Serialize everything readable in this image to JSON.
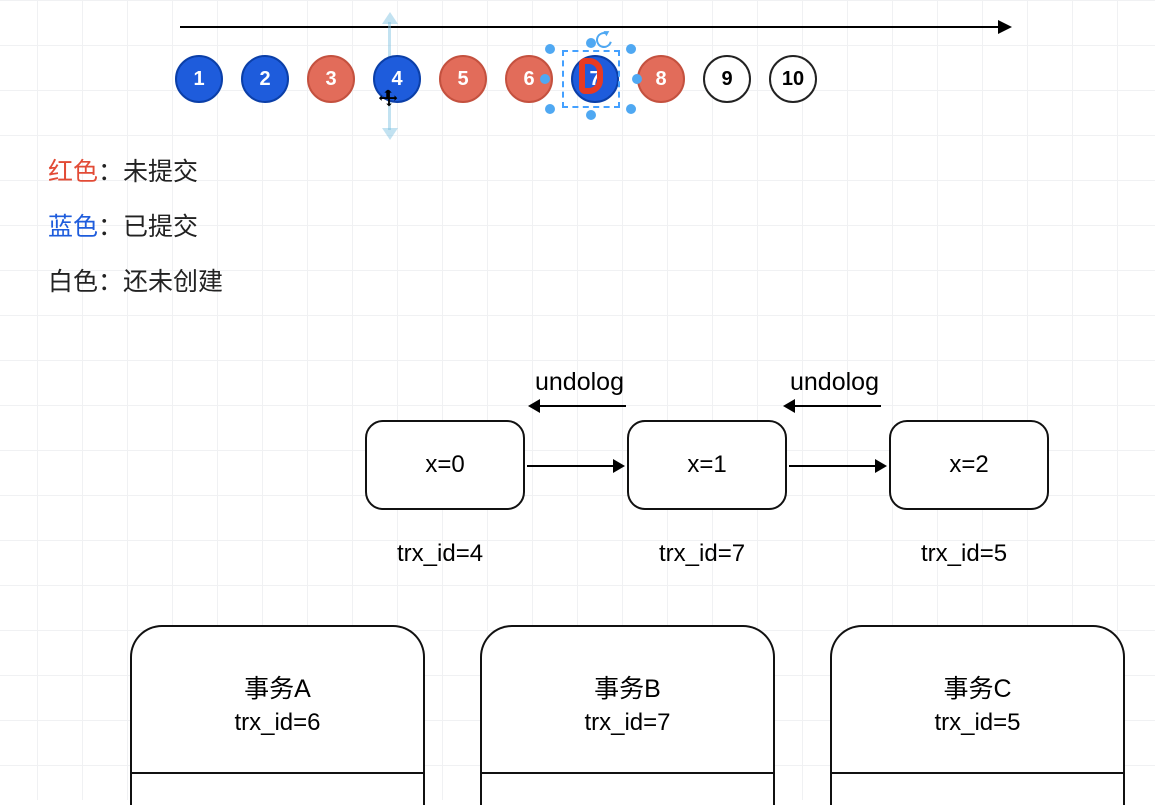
{
  "timeline": {
    "circles": [
      {
        "n": "1",
        "color": "blue"
      },
      {
        "n": "2",
        "color": "blue"
      },
      {
        "n": "3",
        "color": "red"
      },
      {
        "n": "4",
        "color": "blue"
      },
      {
        "n": "5",
        "color": "red"
      },
      {
        "n": "6",
        "color": "red"
      },
      {
        "n": "7",
        "color": "blue"
      },
      {
        "n": "8",
        "color": "red"
      },
      {
        "n": "9",
        "color": "white"
      },
      {
        "n": "10",
        "color": "white"
      }
    ],
    "selected_index": 6,
    "move_cursor_on_index": 3
  },
  "legend": {
    "red_label": "红色",
    "red_desc": "：未提交",
    "blue_label": "蓝色",
    "blue_desc": "：已提交",
    "white_label": "白色",
    "white_desc": "：还未创建"
  },
  "version_chain": {
    "undolog_label": "undolog",
    "nodes": [
      {
        "content": "x=0",
        "trx": "trx_id=4"
      },
      {
        "content": "x=1",
        "trx": "trx_id=7"
      },
      {
        "content": "x=2",
        "trx": "trx_id=5"
      }
    ]
  },
  "transactions": [
    {
      "title": "事务A",
      "trx": "trx_id=6"
    },
    {
      "title": "事务B",
      "trx": "trx_id=7"
    },
    {
      "title": "事务C",
      "trx": "trx_id=5"
    }
  ],
  "colors": {
    "blue": "#1e5cdc",
    "red": "#e26c5a",
    "white": "#ffffff"
  }
}
